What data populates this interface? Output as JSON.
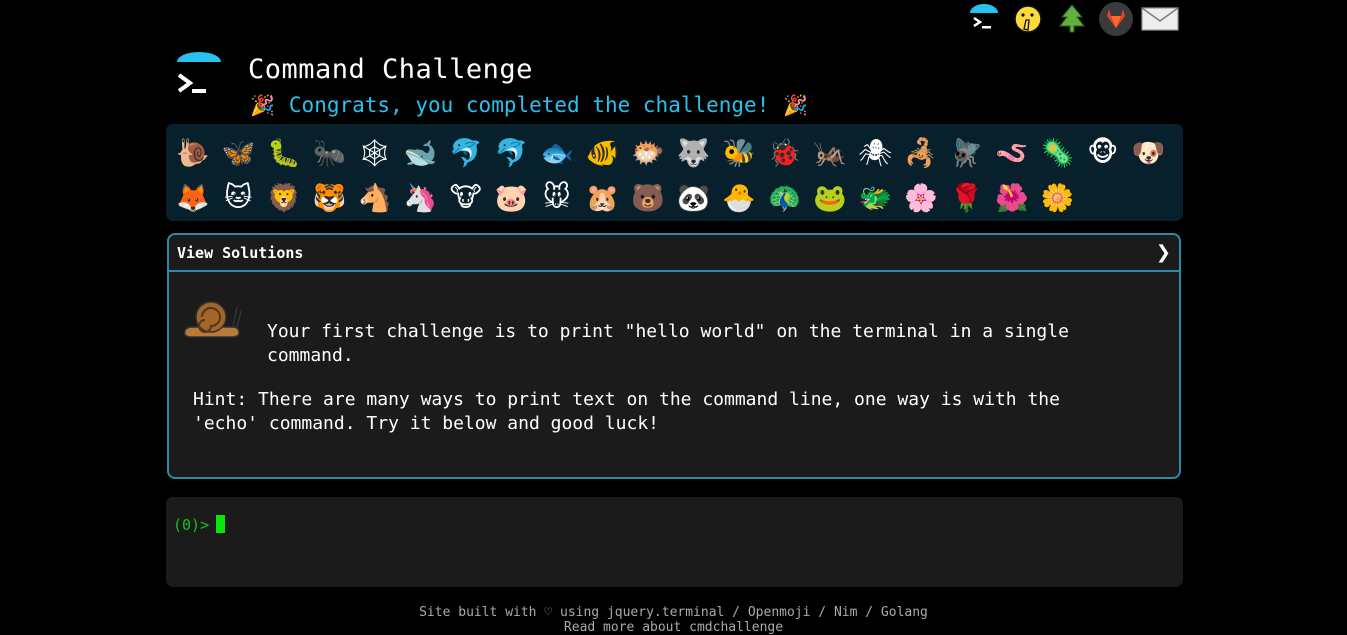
{
  "header": {
    "title": "Command Challenge",
    "congrats": "Congrats, you completed the challenge!",
    "party_emoji": "🎉"
  },
  "top_icons": [
    "terminal-logo-icon",
    "shushing-face-icon",
    "evergreen-tree-icon",
    "gitlab-icon",
    "envelope-icon"
  ],
  "emoji_strip": [
    "🐌",
    "🦋",
    "🐛",
    "🐜",
    "🕸",
    "🐋",
    "🐬",
    "🐬",
    "🐟",
    "🐠",
    "🐡",
    "🐺",
    "🐝",
    "🐞",
    "🦗",
    "🕷",
    "🦂",
    "🪰",
    "🪱",
    "🦠",
    "🐵",
    "🐶",
    "🦊",
    "🐱",
    "🦁",
    "🐯",
    "🐴",
    "🦄",
    "🐮",
    "🐷",
    "🐭",
    "🐹",
    "🐻",
    "🐼",
    "🐣",
    "🦚",
    "🐸",
    "🐲",
    "🌸",
    "🌹",
    "🌺",
    "🌼"
  ],
  "panel": {
    "header_label": "View Solutions",
    "chevron": "❯",
    "challenge_text": "Your first challenge is to print \"hello world\" on the terminal in a single command.",
    "hint_text": "Hint: There are many ways to print text on the command line, one way is with the 'echo' command. Try it below and good luck!"
  },
  "terminal": {
    "prompt": "(0)>"
  },
  "footer": {
    "line1_prefix": "Site built with ♡ using ",
    "links": [
      "jquery.terminal",
      "Openmoji",
      "Nim",
      "Golang"
    ],
    "separator": " / ",
    "line2": "Read more about cmdchallenge"
  },
  "colors": {
    "accent": "#27c2ee",
    "panel_border": "#2a8aa8",
    "prompt": "#1fbd1f",
    "strip_bg": "#08202b"
  }
}
